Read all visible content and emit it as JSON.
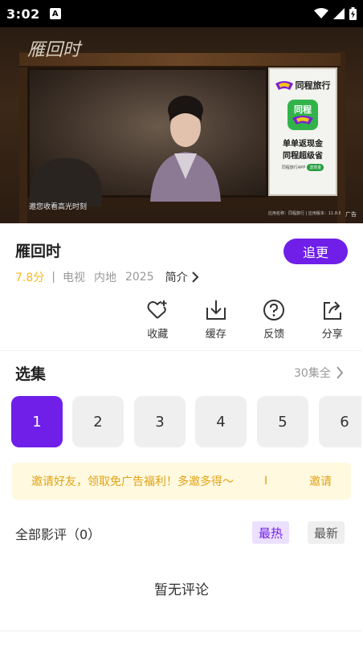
{
  "status_bar": {
    "time": "3:02",
    "notification_icon": "A",
    "icons": [
      "wifi-icon",
      "signal-icon",
      "battery-icon"
    ]
  },
  "video": {
    "logo_text": "雁回时",
    "caption": "邀您收看高光时刻",
    "ad_label": "广告",
    "ad_fine_print": "应用名称：同程旅行 | 应用版本：11.8.8 | 开发者：同程网络科技股份有限公司",
    "ad": {
      "brand": "同程旅行",
      "tile_text": "同程",
      "line1": "单单返现金",
      "line2": "同程超级省",
      "cta_small": "同程旅行APP",
      "cta_button": "送现金"
    }
  },
  "show": {
    "title": "雁回时",
    "follow_label": "追更",
    "score": "7.8分",
    "separator": "|",
    "category": "电视",
    "region": "内地",
    "year": "2025",
    "intro_label": "简介"
  },
  "actions": [
    {
      "label": "收藏",
      "icon": "favorite-heart-plus-icon"
    },
    {
      "label": "缓存",
      "icon": "download-icon"
    },
    {
      "label": "反馈",
      "icon": "help-question-icon"
    },
    {
      "label": "分享",
      "icon": "share-icon"
    }
  ],
  "episodes": {
    "title": "选集",
    "total": "30集全",
    "items": [
      "1",
      "2",
      "3",
      "4",
      "5",
      "6"
    ],
    "selected": "1"
  },
  "invite": {
    "text": "邀请好友，领取免广告福利！多邀多得～",
    "bar": "I",
    "action": "邀请"
  },
  "reviews": {
    "title": "全部影评（0）",
    "sort_hot": "最热",
    "sort_new": "最新",
    "empty_text": "暂无评论"
  },
  "colors": {
    "accent": "#6f1fe8",
    "score": "#f6b91f",
    "invite_bg": "#fff9e0",
    "invite_text": "#e0a315"
  }
}
